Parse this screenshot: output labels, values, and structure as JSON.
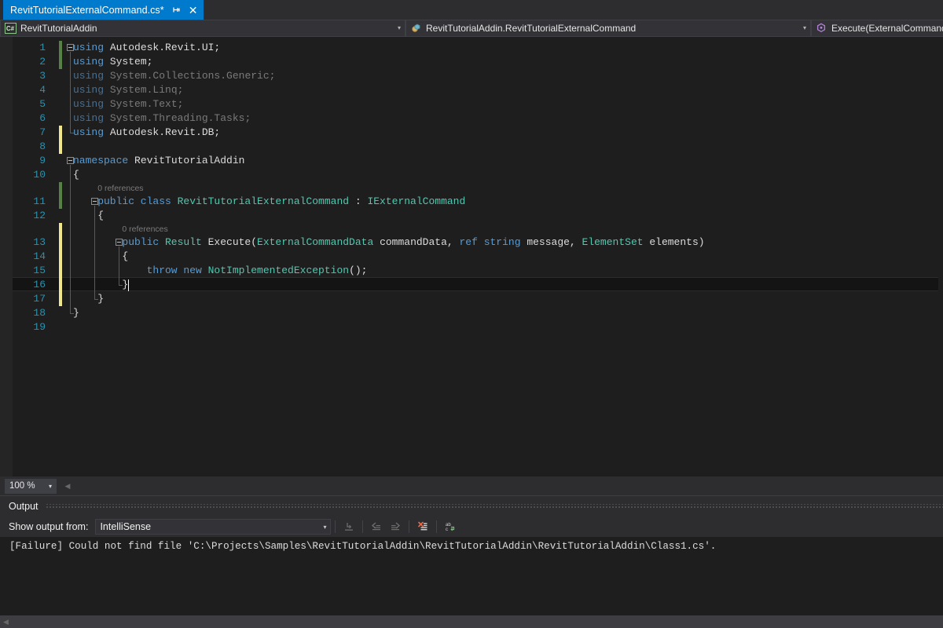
{
  "window": {
    "app": "Visual Studio",
    "theme_colors": {
      "accent": "#007acc",
      "editor_bg": "#1e1e1e",
      "chrome_bg": "#2d2d30",
      "linenum": "#2b91af",
      "keyword": "#569cd6",
      "type": "#4ec9b0",
      "disabled_keyword": "#4a6f8f",
      "codelens": "#7a7a7a",
      "change_saved": "#578046",
      "change_unsaved": "#f0e68c",
      "clear_icon": "#e06c4b"
    }
  },
  "tab": {
    "title": "RevitTutorialExternalCommand.cs*",
    "pin_icon": "pin-icon",
    "close_icon": "close-icon",
    "close_glyph": "✕"
  },
  "navbar": {
    "project": {
      "icon": "csharp-project-icon",
      "badge": "C#",
      "label": "RevitTutorialAddin",
      "arrow": "▾"
    },
    "type": {
      "icon": "class-icon",
      "label": "RevitTutorialAddin.RevitTutorialExternalCommand",
      "arrow": "▾"
    },
    "member": {
      "icon": "method-icon",
      "label": "Execute(ExternalCommandD",
      "arrow": "▾"
    }
  },
  "editor": {
    "lines": [
      {
        "n": "1",
        "indent": 0,
        "tokens": [
          {
            "t": "using ",
            "c": "kw"
          },
          {
            "t": "Autodesk.Revit.UI;",
            "c": "ns"
          }
        ]
      },
      {
        "n": "2",
        "indent": 0,
        "tokens": [
          {
            "t": "using ",
            "c": "kw"
          },
          {
            "t": "System;",
            "c": "ns"
          }
        ]
      },
      {
        "n": "3",
        "indent": 0,
        "tokens": [
          {
            "t": "using ",
            "c": "kw-d"
          },
          {
            "t": "System.Collections.Generic;",
            "c": "ns-d"
          }
        ]
      },
      {
        "n": "4",
        "indent": 0,
        "tokens": [
          {
            "t": "using ",
            "c": "kw-d"
          },
          {
            "t": "System.Linq;",
            "c": "ns-d"
          }
        ]
      },
      {
        "n": "5",
        "indent": 0,
        "tokens": [
          {
            "t": "using ",
            "c": "kw-d"
          },
          {
            "t": "System.Text;",
            "c": "ns-d"
          }
        ]
      },
      {
        "n": "6",
        "indent": 0,
        "tokens": [
          {
            "t": "using ",
            "c": "kw-d"
          },
          {
            "t": "System.Threading.Tasks;",
            "c": "ns-d"
          }
        ]
      },
      {
        "n": "7",
        "indent": 0,
        "tokens": [
          {
            "t": "using ",
            "c": "kw"
          },
          {
            "t": "Autodesk.Revit.DB;",
            "c": "ns"
          }
        ]
      },
      {
        "n": "8",
        "indent": 0,
        "tokens": []
      },
      {
        "n": "9",
        "indent": 0,
        "tokens": [
          {
            "t": "namespace ",
            "c": "kw"
          },
          {
            "t": "RevitTutorialAddin",
            "c": "pln"
          }
        ]
      },
      {
        "n": "10",
        "indent": 0,
        "tokens": [
          {
            "t": "{",
            "c": "pln"
          }
        ]
      },
      {
        "n": "11",
        "indent": 1,
        "tokens": [
          {
            "t": "public ",
            "c": "kw"
          },
          {
            "t": "class ",
            "c": "kw"
          },
          {
            "t": "RevitTutorialExternalCommand",
            "c": "typ"
          },
          {
            "t": " : ",
            "c": "pln"
          },
          {
            "t": "IExternalCommand",
            "c": "typ"
          }
        ]
      },
      {
        "n": "12",
        "indent": 1,
        "tokens": [
          {
            "t": "{",
            "c": "pln"
          }
        ]
      },
      {
        "n": "13",
        "indent": 2,
        "tokens": [
          {
            "t": "public ",
            "c": "kw"
          },
          {
            "t": "Result ",
            "c": "typ"
          },
          {
            "t": "Execute(",
            "c": "pln"
          },
          {
            "t": "ExternalCommandData",
            "c": "typ"
          },
          {
            "t": " commandData, ",
            "c": "pln"
          },
          {
            "t": "ref ",
            "c": "kw"
          },
          {
            "t": "string",
            "c": "kw"
          },
          {
            "t": " message, ",
            "c": "pln"
          },
          {
            "t": "ElementSet",
            "c": "typ"
          },
          {
            "t": " elements)",
            "c": "pln"
          }
        ]
      },
      {
        "n": "14",
        "indent": 2,
        "tokens": [
          {
            "t": "{",
            "c": "pln"
          }
        ]
      },
      {
        "n": "15",
        "indent": 3,
        "tokens": [
          {
            "t": "throw ",
            "c": "kw"
          },
          {
            "t": "new ",
            "c": "kw"
          },
          {
            "t": "NotImplementedException",
            "c": "typ"
          },
          {
            "t": "();",
            "c": "pln"
          }
        ]
      },
      {
        "n": "16",
        "indent": 2,
        "tokens": [
          {
            "t": "}",
            "c": "pln"
          }
        ]
      },
      {
        "n": "17",
        "indent": 1,
        "tokens": [
          {
            "t": "}",
            "c": "pln"
          }
        ]
      },
      {
        "n": "18",
        "indent": 0,
        "tokens": [
          {
            "t": "}",
            "c": "pln"
          }
        ]
      },
      {
        "n": "19",
        "indent": 0,
        "tokens": []
      }
    ],
    "codelens": [
      {
        "text": "0 references",
        "for_line": "11"
      },
      {
        "text": "0 references",
        "for_line": "13"
      }
    ],
    "current_line": "16",
    "caret_line": "16"
  },
  "zoombar": {
    "zoom_value": "100 %",
    "zoom_arrow": "▾",
    "scroll_left_glyph": "◀"
  },
  "output": {
    "title": "Output",
    "filter_label": "Show output from:",
    "source": "IntelliSense",
    "source_arrow": "▾",
    "toolbar": [
      {
        "name": "find-message-in-code-button",
        "enabled": false
      },
      {
        "name": "go-to-previous-message-button",
        "enabled": false
      },
      {
        "name": "go-to-next-message-button",
        "enabled": false
      },
      {
        "name": "clear-all-button",
        "enabled": true
      },
      {
        "name": "toggle-word-wrap-button",
        "enabled": true
      }
    ],
    "messages": [
      "[Failure] Could not find file 'C:\\Projects\\Samples\\RevitTutorialAddin\\RevitTutorialAddin\\RevitTutorialAddin\\Class1.cs'."
    ],
    "scroll_left_glyph": "◀"
  }
}
